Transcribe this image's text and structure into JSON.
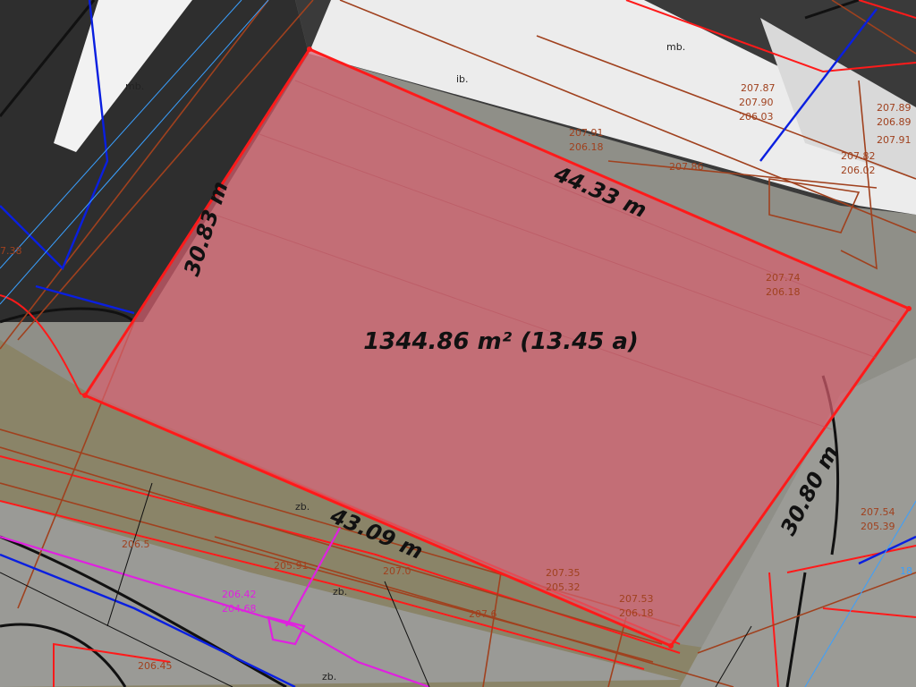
{
  "measurement": {
    "area_label": "1344.86 m² (13.45 a)",
    "edges": [
      {
        "id": "top",
        "label": "44.33 m"
      },
      {
        "id": "left",
        "label": "30.83 m"
      },
      {
        "id": "bottom",
        "label": "43.09 m"
      },
      {
        "id": "right",
        "label": "30.80 m"
      }
    ]
  },
  "building_labels": [
    "ib.",
    "mb.",
    "mb.",
    "zb.",
    "zb.",
    "zb."
  ],
  "utility_labels": [
    "207.87",
    "207.90",
    "206.03",
    "207.91",
    "206.18",
    "207.86",
    "207.89",
    "206.89",
    "207.91",
    "207.82",
    "206.02",
    "207.74",
    "206.18",
    "207.54",
    "205.39",
    "207.35",
    "205.32",
    "207.53",
    "206.18",
    "206.42",
    "204.68",
    "207.0",
    "205.91",
    "207.6",
    "206.5",
    "206.45",
    "7.38",
    "18"
  ],
  "colors": {
    "polygon_fill": "#d9606f",
    "polygon_stroke": "#ff1a1a",
    "sewer": "#a0411e",
    "water": "#0a1fe0",
    "gas": "#e020e0",
    "light_line": "#3aa0ff",
    "road": "#2c2c2c",
    "roof_white": "#ececec"
  }
}
